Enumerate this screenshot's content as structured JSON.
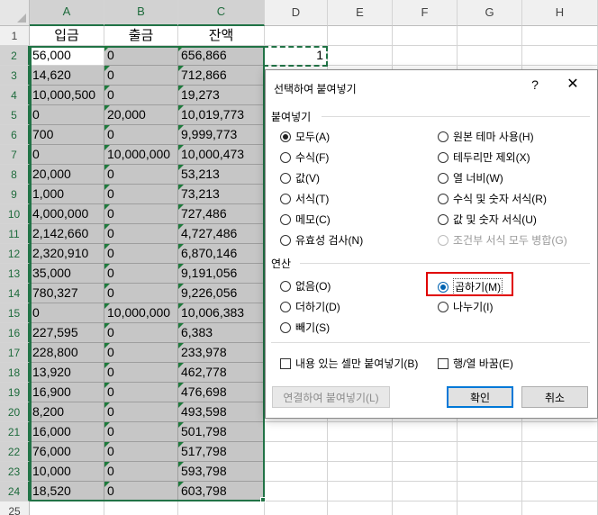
{
  "sheet": {
    "columns": [
      "A",
      "B",
      "C",
      "D",
      "E",
      "F",
      "G",
      "H"
    ],
    "rows": [
      "1",
      "2",
      "3",
      "4",
      "5",
      "6",
      "7",
      "8",
      "9",
      "10",
      "11",
      "12",
      "13",
      "14",
      "15",
      "16",
      "17",
      "18",
      "19",
      "20",
      "21",
      "22",
      "23",
      "24",
      "25"
    ],
    "headers": [
      "입금",
      "출금",
      "잔액"
    ],
    "data": [
      [
        "56,000",
        "0",
        "656,866"
      ],
      [
        "14,620",
        "0",
        "712,866"
      ],
      [
        "10,000,500",
        "0",
        "19,273"
      ],
      [
        "0",
        "20,000",
        "10,019,773"
      ],
      [
        "700",
        "0",
        "9,999,773"
      ],
      [
        "0",
        "10,000,000",
        "10,000,473"
      ],
      [
        "20,000",
        "0",
        "53,213"
      ],
      [
        "1,000",
        "0",
        "73,213"
      ],
      [
        "4,000,000",
        "0",
        "727,486"
      ],
      [
        "2,142,660",
        "0",
        "4,727,486"
      ],
      [
        "2,320,910",
        "0",
        "6,870,146"
      ],
      [
        "35,000",
        "0",
        "9,191,056"
      ],
      [
        "780,327",
        "0",
        "9,226,056"
      ],
      [
        "0",
        "10,000,000",
        "10,006,383"
      ],
      [
        "227,595",
        "0",
        "6,383"
      ],
      [
        "228,800",
        "0",
        "233,978"
      ],
      [
        "13,920",
        "0",
        "462,778"
      ],
      [
        "16,900",
        "0",
        "476,698"
      ],
      [
        "8,200",
        "0",
        "493,598"
      ],
      [
        "16,000",
        "0",
        "501,798"
      ],
      [
        "76,000",
        "0",
        "517,798"
      ],
      [
        "10,000",
        "0",
        "593,798"
      ],
      [
        "18,520",
        "0",
        "603,798"
      ]
    ],
    "d2_value": "1"
  },
  "dialog": {
    "title": "선택하여 붙여넣기",
    "help": "?",
    "close": "✕",
    "paste_label": "붙여넣기",
    "paste_left": [
      "모두(A)",
      "수식(F)",
      "값(V)",
      "서식(T)",
      "메모(C)",
      "유효성 검사(N)"
    ],
    "paste_right": [
      "원본 테마 사용(H)",
      "테두리만 제외(X)",
      "열 너비(W)",
      "수식 및 숫자 서식(R)",
      "값 및 숫자 서식(U)",
      "조건부 서식 모두 병합(G)"
    ],
    "operation_label": "연산",
    "op_left": [
      "없음(O)",
      "더하기(D)",
      "빼기(S)"
    ],
    "op_right": [
      "곱하기(M)",
      "나누기(I)"
    ],
    "skip_blanks": "내용 있는 셀만 붙여넣기(B)",
    "transpose": "행/열 바꿈(E)",
    "paste_link": "연결하여 붙여넣기(L)",
    "ok": "확인",
    "cancel": "취소"
  },
  "colors": {
    "excel_green": "#217346",
    "highlight_red": "#e00000",
    "selected_fill": "#c6c6c6",
    "radio_blue": "#0063b1"
  }
}
